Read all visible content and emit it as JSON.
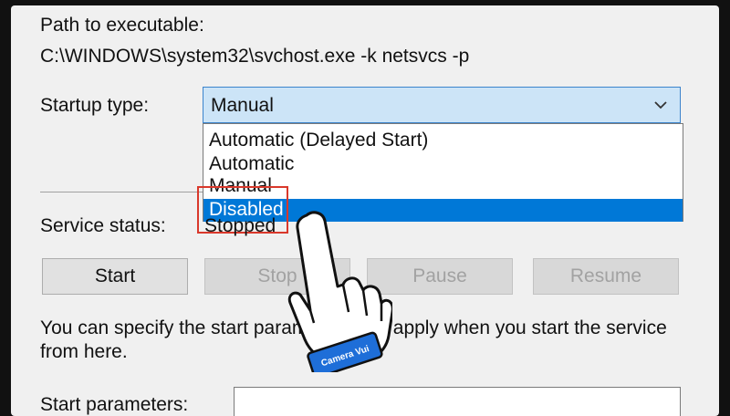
{
  "path_label": "Path to executable:",
  "path_value": "C:\\WINDOWS\\system32\\svchost.exe -k netsvcs -p",
  "startup": {
    "label": "Startup type:",
    "selected": "Manual",
    "options": [
      "Automatic (Delayed Start)",
      "Automatic",
      "Manual",
      "Disabled"
    ],
    "highlighted": "Disabled"
  },
  "status": {
    "label": "Service status:",
    "value": "Stopped"
  },
  "buttons": {
    "start": "Start",
    "stop": "Stop",
    "pause": "Pause",
    "resume": "Resume"
  },
  "info_text_line1": "You can specify the start parameters that apply when you start the service",
  "info_text_line2": "from here.",
  "params_label": "Start parameters:",
  "hand_badge": "Camera Vui",
  "icons": {
    "dropdown": "chevron-down-icon",
    "pointer": "hand-pointer-icon"
  },
  "colors": {
    "highlight": "#0078d7",
    "callout": "#d9382b",
    "badge": "#1e6ed8"
  }
}
